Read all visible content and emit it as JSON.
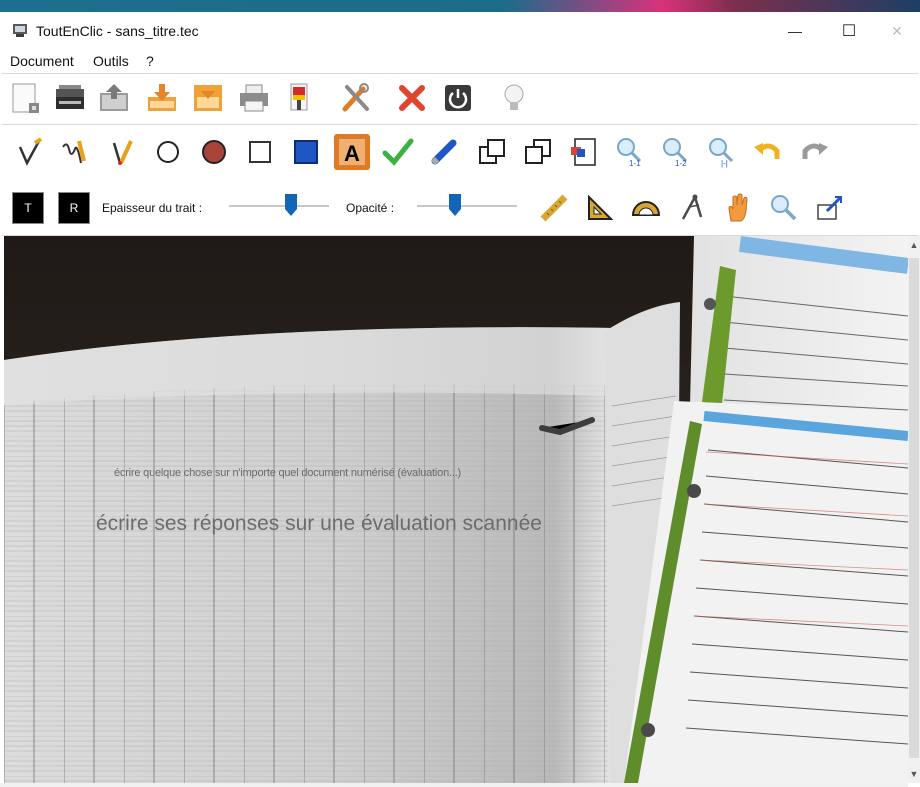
{
  "window": {
    "title": "ToutEnClic - sans_titre.tec",
    "minimize": "—",
    "maximize": "☐",
    "close": "✕"
  },
  "menu": {
    "items": [
      "Document",
      "Outils",
      "?"
    ]
  },
  "toolbar1": {
    "icons": [
      "new-document-icon",
      "scanner-icon",
      "open-folder-icon",
      "download-icon",
      "save-icon",
      "print-icon",
      "paint-bucket-icon",
      "tools-icon",
      "delete-icon",
      "power-icon",
      "lightbulb-icon"
    ]
  },
  "toolbar2": {
    "icons": [
      "pencil-check-icon",
      "freehand-pen-icon",
      "pointer-pen-icon",
      "circle-outline-icon",
      "circle-filled-icon",
      "square-outline-icon",
      "square-filled-icon",
      "text-tool-icon",
      "checkmark-icon",
      "eraser-icon",
      "bring-front-icon",
      "send-back-icon",
      "insert-image-icon",
      "zoom-1-1-icon",
      "zoom-1-2-icon",
      "zoom-fit-icon",
      "undo-icon",
      "redo-icon"
    ]
  },
  "toolbar3": {
    "t_button": "T",
    "r_button": "R",
    "thickness_label": "Epaisseur du trait :",
    "opacity_label": "Opacité :",
    "thickness_value": 0.62,
    "opacity_value": 0.38,
    "icons": [
      "ruler-icon",
      "set-square-icon",
      "protractor-icon",
      "compass-icon",
      "hand-icon",
      "magnifier-icon",
      "capture-icon"
    ]
  },
  "canvas": {
    "overlay_small": "écrire quelque chose sur n'importe quel document numérisé (évaluation...)",
    "overlay_big": "écrire ses réponses sur une évaluation scannée"
  },
  "colors": {
    "accent": "#1e6e8f",
    "slider_thumb": "#1366b5",
    "text_tool_bg": "#e07a24"
  }
}
